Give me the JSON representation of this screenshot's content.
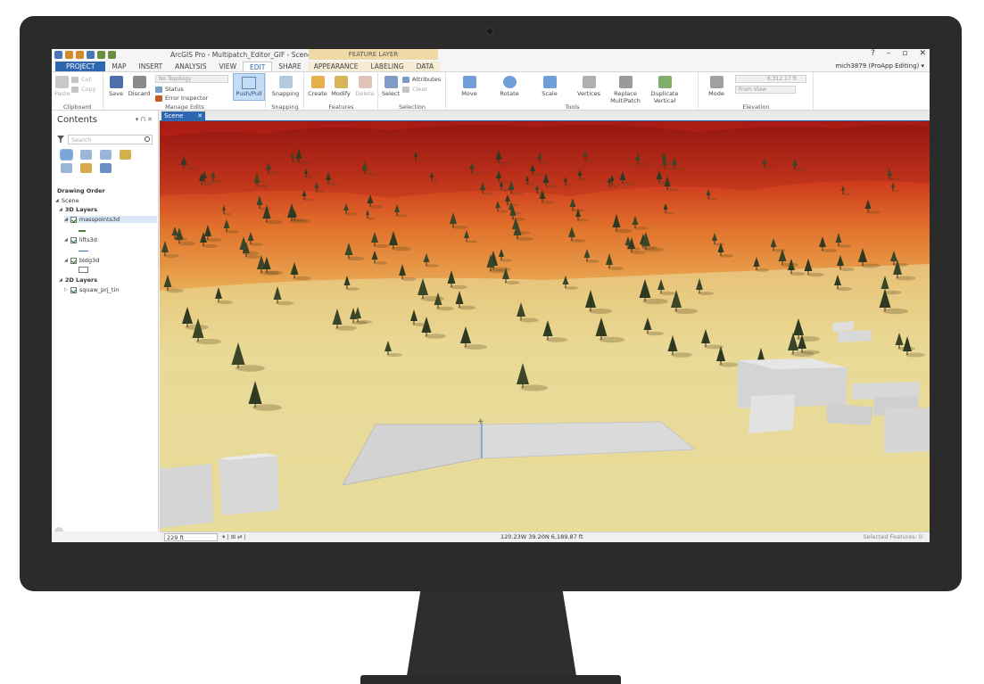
{
  "app": {
    "title": "ArcGIS Pro - Multipatch_Editor_GIF - Scene",
    "context_tab_group": "FEATURE LAYER",
    "user": "mich3879 (ProApp Editing) ▾",
    "window_controls": [
      "?",
      "–",
      "▫",
      "✕"
    ]
  },
  "tabs": [
    "PROJECT",
    "MAP",
    "INSERT",
    "ANALYSIS",
    "VIEW",
    "EDIT",
    "SHARE",
    "APPEARANCE",
    "LABELING",
    "DATA"
  ],
  "active_tab": "EDIT",
  "ribbon": {
    "clipboard": {
      "paste": "Paste",
      "cut": "Cut",
      "copy": "Copy",
      "label": "Clipboard"
    },
    "manage_edits": {
      "save": "Save",
      "discard": "Discard",
      "topology": "No Topology",
      "status": "Status",
      "error_inspector": "Error Inspector",
      "pushpull": "Push/Pull",
      "label": "Manage Edits"
    },
    "snapping": {
      "button": "Snapping",
      "label": "Snapping"
    },
    "features": {
      "create": "Create",
      "modify": "Modify",
      "delete": "Delete",
      "label": "Features"
    },
    "selection": {
      "select": "Select",
      "attributes": "Attributes",
      "clear": "Clear",
      "label": "Selection"
    },
    "tools": {
      "items": [
        "Move",
        "Rotate",
        "Scale",
        "Vertices",
        "Replace MultiPatch",
        "Duplicate Vertical"
      ],
      "label": "Tools"
    },
    "elevation": {
      "mode": "Mode",
      "value": "6,312.17 ft",
      "reference": "From View",
      "label": "Elevation"
    }
  },
  "contents": {
    "title": "Contents",
    "pane_buttons": "▾ ⊓ ✕",
    "search_placeholder": "Search",
    "section": "Drawing Order",
    "scene": "Scene",
    "group_3d": "3D Layers",
    "layers_3d": [
      "masspoints3d",
      "lifts3d",
      "bldg3d"
    ],
    "group_2d": "2D Layers",
    "layers_2d": [
      "squaw_prj_tin"
    ]
  },
  "view": {
    "tab_label": "Scene",
    "close": "✕"
  },
  "status": {
    "scale": "229 ft",
    "icons": "▾ | ⊞ ⇄ |",
    "coords": "120.23W 39.20N  6,189.87 ft",
    "selected_features": "Selected Features: 0"
  },
  "colors": {
    "accent": "#2f66b0",
    "hillside_red": "#c4291c",
    "hillside_orange": "#e0782e",
    "meadow": "#e6dc9c",
    "building": "#d6d6d6"
  }
}
